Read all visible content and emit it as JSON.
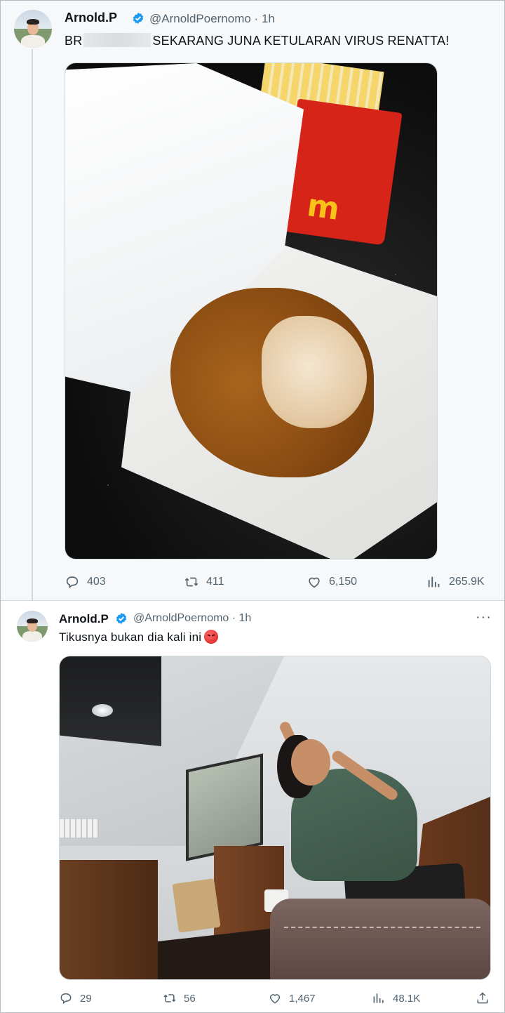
{
  "tweet1": {
    "name": "Arnold.P",
    "handle_time": "@ArnoldPoernomo · 1h",
    "text_prefix": "BR",
    "text_suffix": "SEKARANG JUNA KETULARAN VIRUS RENATTA!",
    "replies": "403",
    "retweets": "411",
    "likes": "6,150",
    "views": "265.9K"
  },
  "tweet2": {
    "name": "Arnold.P",
    "handle_time": "@ArnoldPoernomo · 1h",
    "more": "···",
    "text": "Tikusnya bukan dia kali ini",
    "replies": "29",
    "retweets": "56",
    "likes": "1,467",
    "views": "48.1K"
  },
  "images": {
    "photo1_logo": "m"
  },
  "colors": {
    "verified": "#1d9bf0",
    "muted": "#536471",
    "text": "#0f1419"
  }
}
